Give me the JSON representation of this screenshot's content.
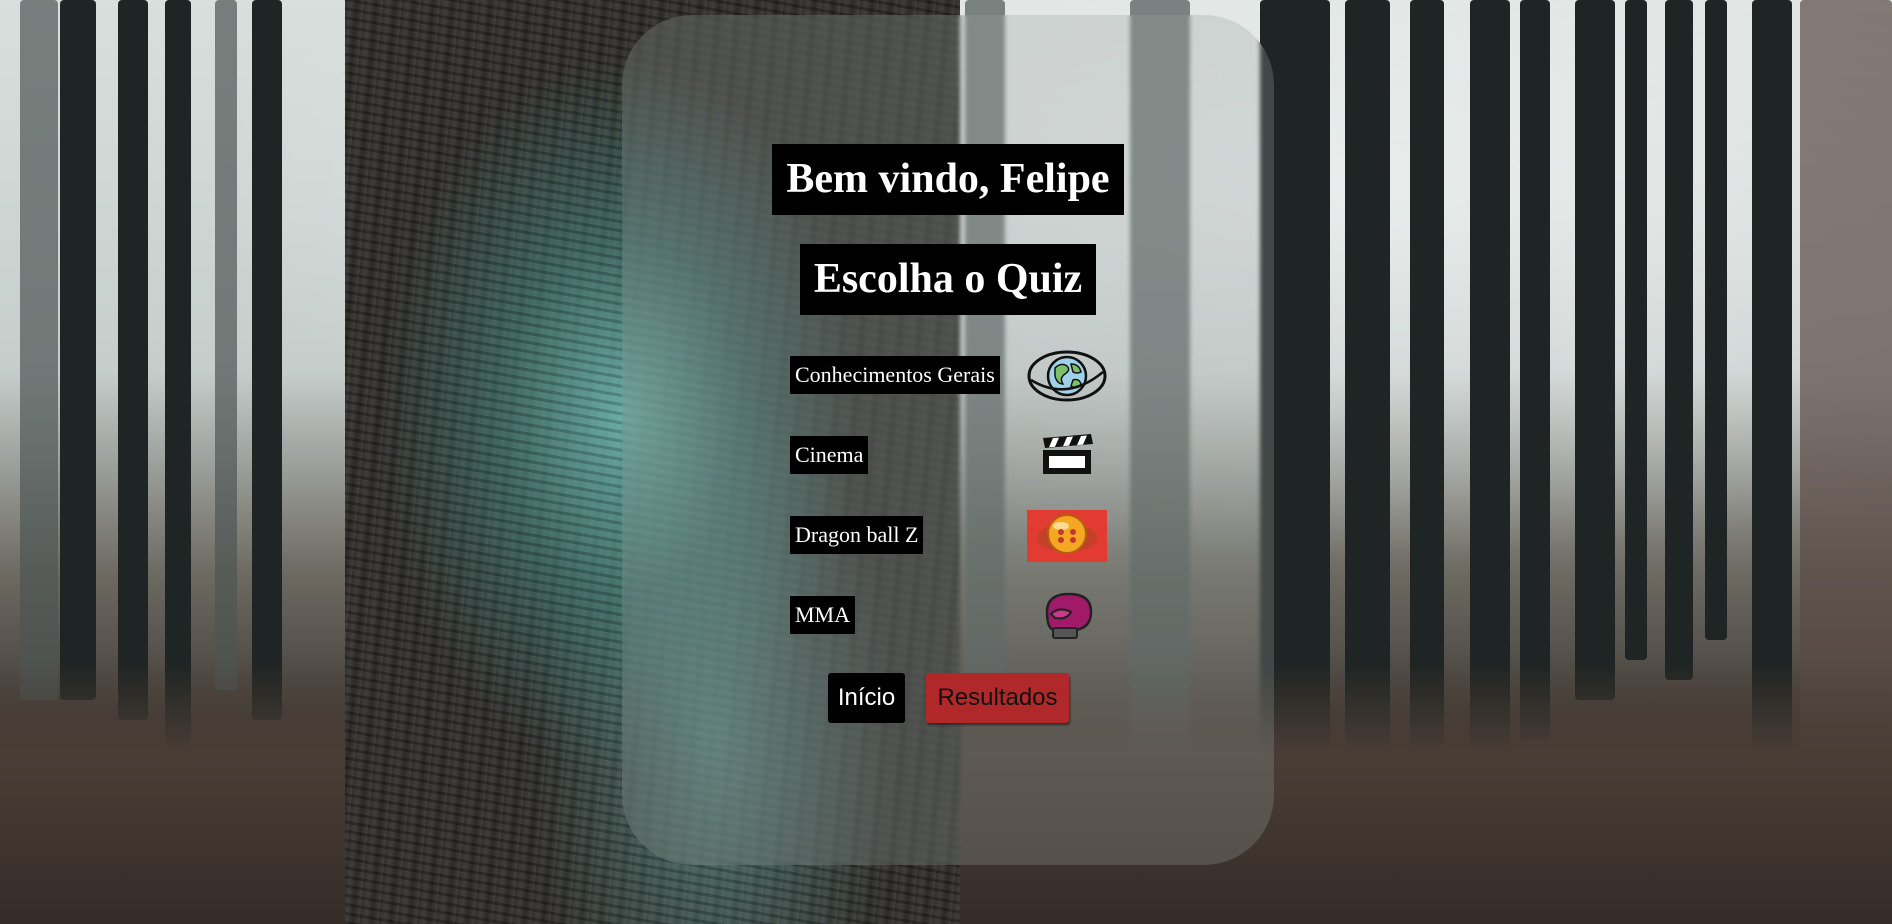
{
  "header": {
    "welcome": "Bem vindo, Felipe",
    "subtitle": "Escolha o Quiz"
  },
  "quizzes": [
    {
      "label": "Conhecimentos Gerais",
      "icon": "globe-icon"
    },
    {
      "label": "Cinema",
      "icon": "clapperboard-icon"
    },
    {
      "label": "Dragon ball Z",
      "icon": "dragon-ball-icon"
    },
    {
      "label": "MMA",
      "icon": "boxing-glove-icon"
    }
  ],
  "buttons": {
    "home": "Início",
    "results": "Resultados"
  },
  "colors": {
    "results_button": "#b0282a",
    "dragon_ball_bg": "#e23b32"
  }
}
